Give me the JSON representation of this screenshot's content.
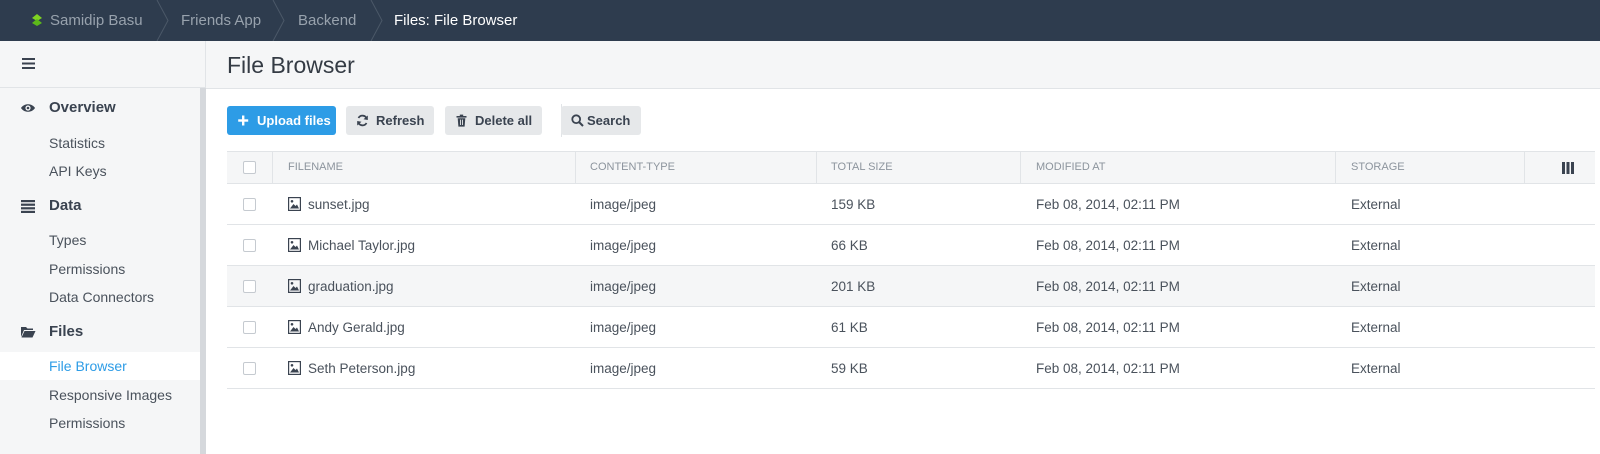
{
  "breadcrumb": {
    "items": [
      "Samidip Basu",
      "Friends App",
      "Backend",
      "Files: File Browser"
    ]
  },
  "sidebar": {
    "toggle_icon": "hamburger-icon",
    "sections": [
      {
        "label": "Overview",
        "icon": "eye-icon",
        "items": [
          "Statistics",
          "API Keys"
        ]
      },
      {
        "label": "Data",
        "icon": "list-icon",
        "items": [
          "Types",
          "Permissions",
          "Data Connectors"
        ]
      },
      {
        "label": "Files",
        "icon": "folder-open-icon",
        "items": [
          "File Browser",
          "Responsive Images",
          "Permissions"
        ]
      }
    ],
    "active_item": "File Browser"
  },
  "main": {
    "title": "File Browser",
    "toolbar": {
      "upload": "Upload files",
      "refresh": "Refresh",
      "delete_all": "Delete all",
      "search": "Search"
    },
    "table": {
      "columns": [
        "FILENAME",
        "CONTENT-TYPE",
        "TOTAL SIZE",
        "MODIFIED AT",
        "STORAGE"
      ],
      "rows": [
        {
          "filename": "sunset.jpg",
          "content_type": "image/jpeg",
          "size": "159 KB",
          "modified": "Feb 08, 2014, 02:11 PM",
          "storage": "External"
        },
        {
          "filename": "Michael Taylor.jpg",
          "content_type": "image/jpeg",
          "size": "66 KB",
          "modified": "Feb 08, 2014, 02:11 PM",
          "storage": "External"
        },
        {
          "filename": "graduation.jpg",
          "content_type": "image/jpeg",
          "size": "201 KB",
          "modified": "Feb 08, 2014, 02:11 PM",
          "storage": "External"
        },
        {
          "filename": "Andy Gerald.jpg",
          "content_type": "image/jpeg",
          "size": "61 KB",
          "modified": "Feb 08, 2014, 02:11 PM",
          "storage": "External"
        },
        {
          "filename": "Seth Peterson.jpg",
          "content_type": "image/jpeg",
          "size": "59 KB",
          "modified": "Feb 08, 2014, 02:11 PM",
          "storage": "External"
        }
      ]
    }
  },
  "colors": {
    "topbar": "#2e3c4e",
    "accent": "#2d9ce6",
    "logo": "#7ed321"
  }
}
